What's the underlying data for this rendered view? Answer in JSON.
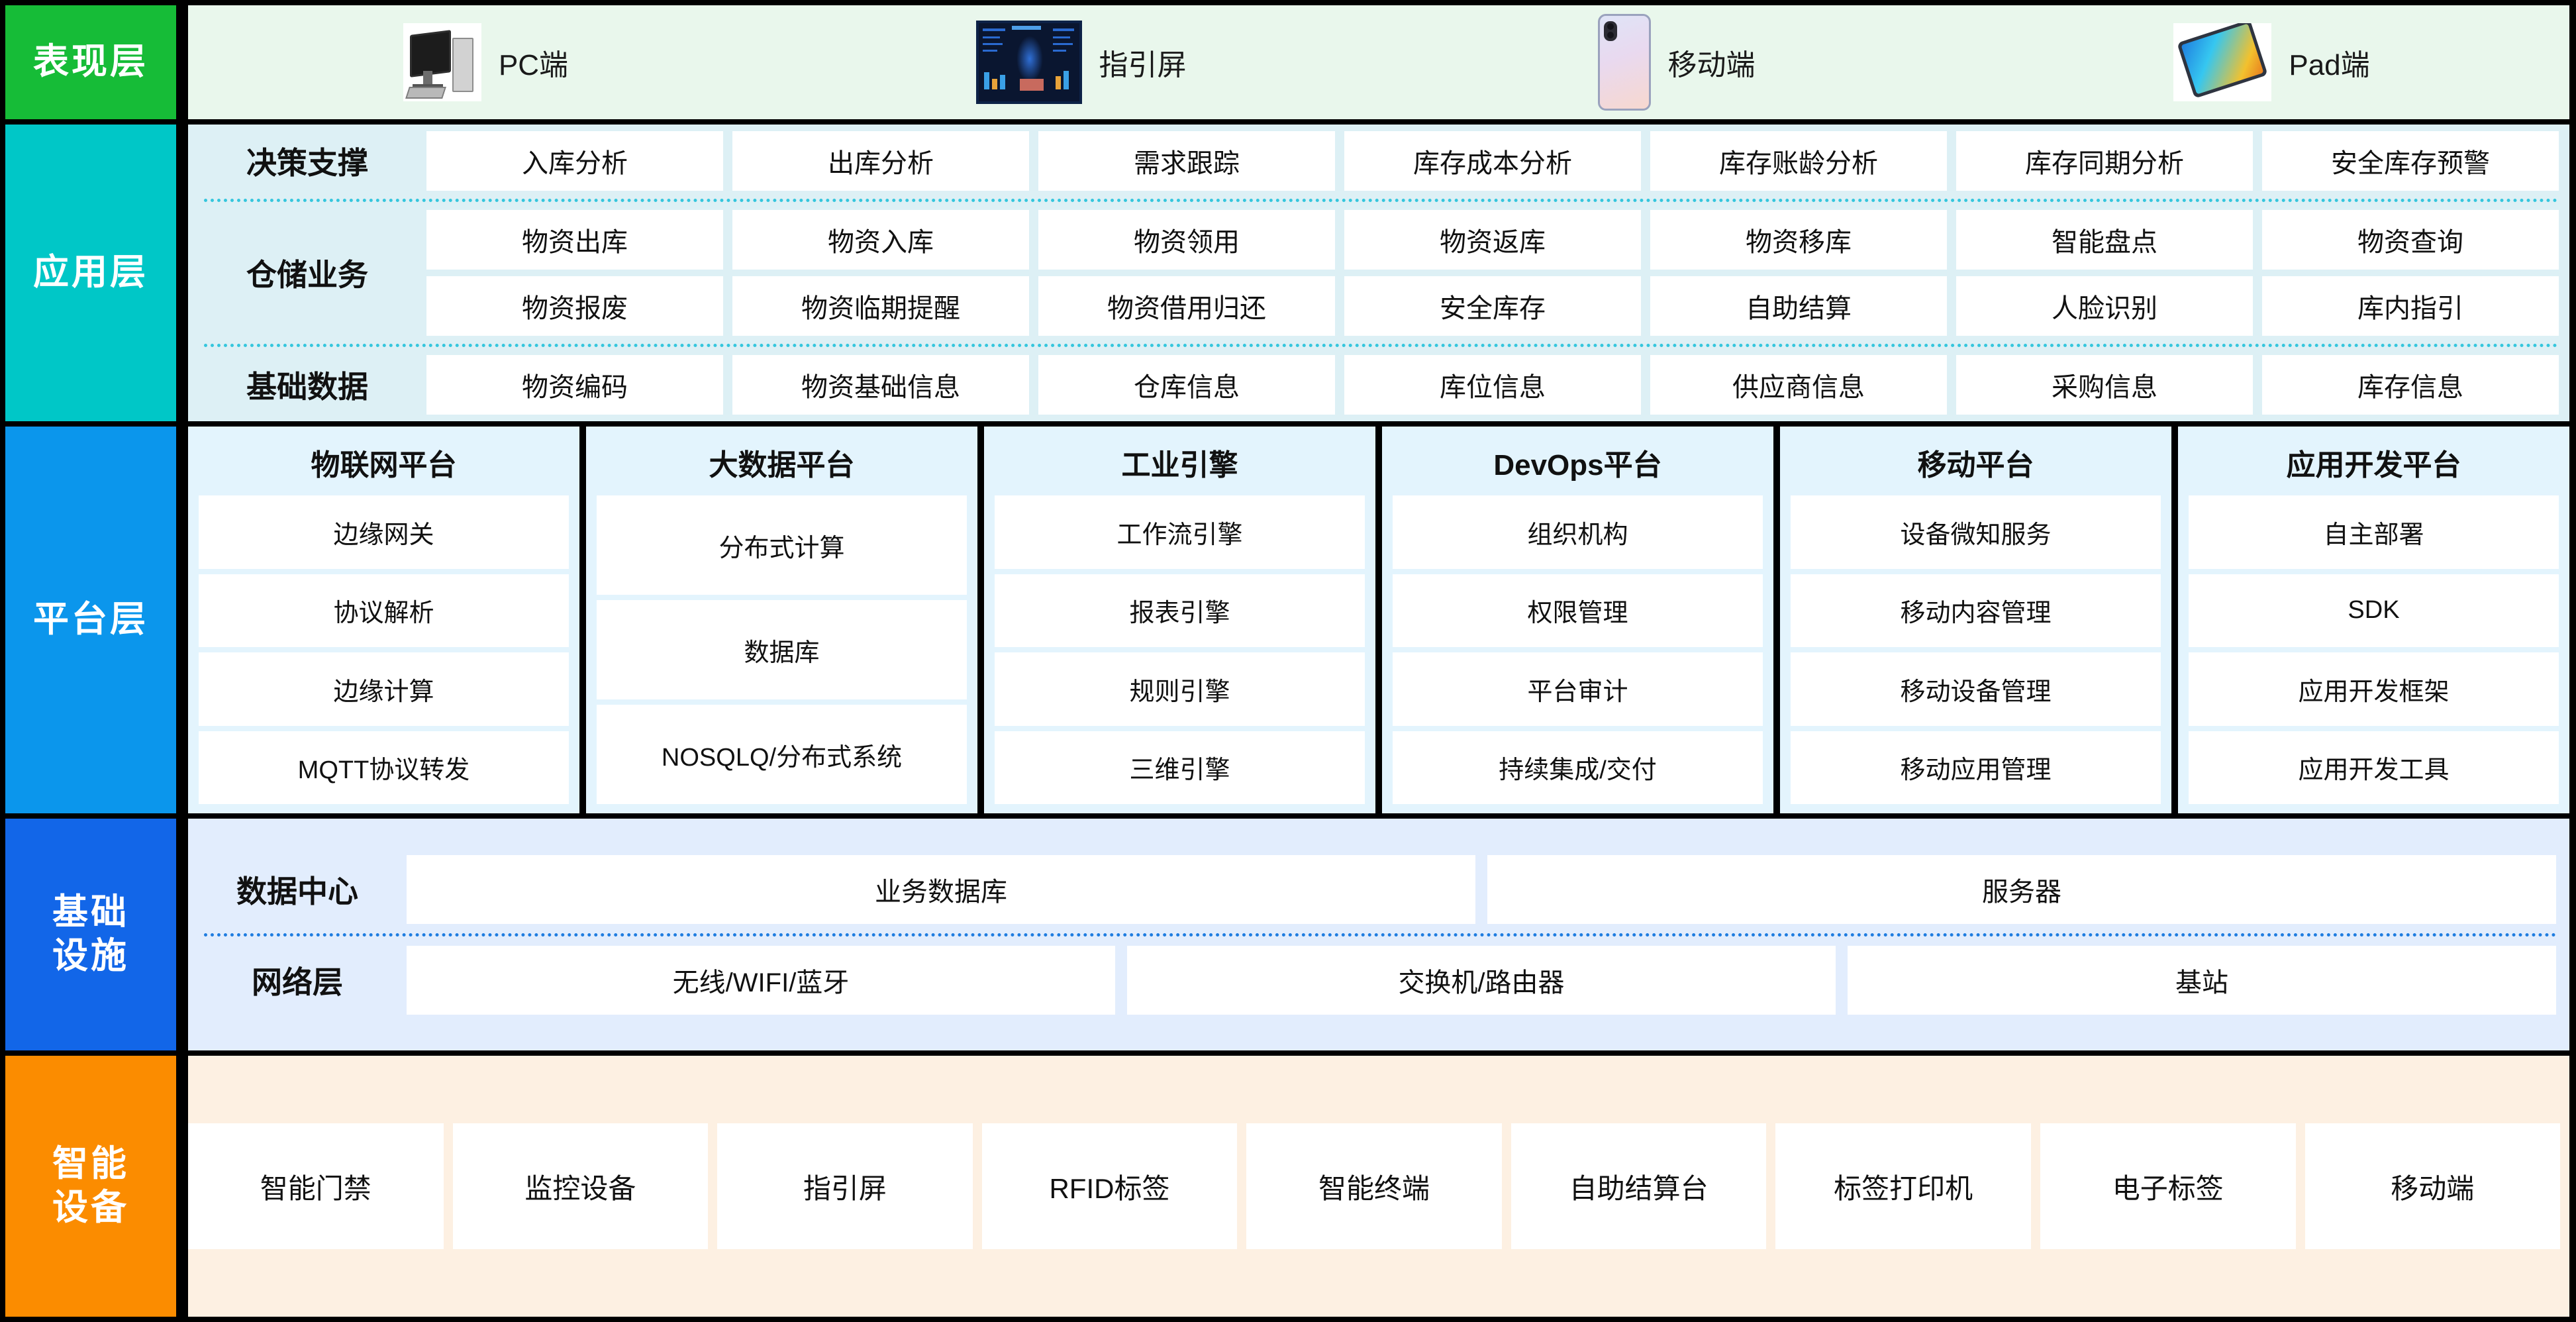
{
  "layers": {
    "presentation": {
      "label": [
        "表现层"
      ],
      "color": "#16bc37",
      "items": [
        {
          "icon": "desktop-pc-icon",
          "label": "PC端"
        },
        {
          "icon": "guidance-screen-icon",
          "label": "指引屏"
        },
        {
          "icon": "mobile-phone-icon",
          "label": "移动端"
        },
        {
          "icon": "tablet-pad-icon",
          "label": "Pad端"
        }
      ]
    },
    "application": {
      "label": [
        "应用层"
      ],
      "color": "#00c7c7",
      "groups": [
        {
          "title": "决策支撑",
          "rows": [
            [
              "入库分析",
              "出库分析",
              "需求跟踪",
              "库存成本分析",
              "库存账龄分析",
              "库存同期分析",
              "安全库存预警"
            ]
          ]
        },
        {
          "title": "仓储业务",
          "rows": [
            [
              "物资出库",
              "物资入库",
              "物资领用",
              "物资返库",
              "物资移库",
              "智能盘点",
              "物资查询"
            ],
            [
              "物资报废",
              "物资临期提醒",
              "物资借用归还",
              "安全库存",
              "自助结算",
              "人脸识别",
              "库内指引"
            ]
          ]
        },
        {
          "title": "基础数据",
          "rows": [
            [
              "物资编码",
              "物资基础信息",
              "仓库信息",
              "库位信息",
              "供应商信息",
              "采购信息",
              "库存信息"
            ]
          ]
        }
      ]
    },
    "platform": {
      "label": [
        "平台层"
      ],
      "color": "#0b96ec",
      "columns": [
        {
          "title": "物联网平台",
          "items": [
            "边缘网关",
            "协议解析",
            "边缘计算",
            "MQTT协议转发"
          ]
        },
        {
          "title": "大数据平台",
          "items": [
            "分布式计算",
            "数据库",
            "NOSQLQ/分布式系统"
          ]
        },
        {
          "title": "工业引擎",
          "items": [
            "工作流引擎",
            "报表引擎",
            "规则引擎",
            "三维引擎"
          ]
        },
        {
          "title": "DevOps平台",
          "items": [
            "组织机构",
            "权限管理",
            "平台审计",
            "持续集成/交付"
          ]
        },
        {
          "title": "移动平台",
          "items": [
            "设备微知服务",
            "移动内容管理",
            "移动设备管理",
            "移动应用管理"
          ]
        },
        {
          "title": "应用开发平台",
          "items": [
            "自主部署",
            "SDK",
            "应用开发框架",
            "应用开发工具"
          ]
        }
      ]
    },
    "infrastructure": {
      "label": [
        "基础",
        "设施"
      ],
      "color": "#1266e8",
      "groups": [
        {
          "title": "数据中心",
          "cells": [
            "业务数据库",
            "服务器"
          ]
        },
        {
          "title": "网络层",
          "cells": [
            "无线/WIFI/蓝牙",
            "交换机/路由器",
            "基站"
          ]
        }
      ]
    },
    "devices": {
      "label": [
        "智能",
        "设备"
      ],
      "color": "#fb8c00",
      "items": [
        "智能门禁",
        "监控设备",
        "指引屏",
        "RFID标签",
        "智能终端",
        "自助结算台",
        "标签打印机",
        "电子标签",
        "移动端"
      ]
    }
  }
}
